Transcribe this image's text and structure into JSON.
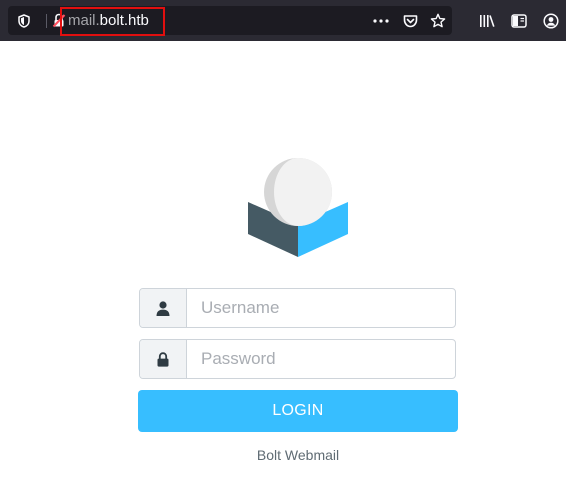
{
  "browser": {
    "url": {
      "host_prefix": "mail.",
      "domain": "bolt.htb"
    },
    "icons": {
      "tracking_protection": "shield-icon",
      "insecure_connection": "insecure-lock-icon",
      "page_actions": "more-horizontal-icon",
      "pocket": "pocket-icon",
      "bookmark": "star-icon",
      "library": "library-icon",
      "sidebar": "sidebar-icon",
      "account": "account-icon"
    },
    "highlight_color": "#e10f0f"
  },
  "login": {
    "logo": "roundcube-logo",
    "username": {
      "value": "",
      "placeholder": "Username",
      "icon": "user-icon"
    },
    "password": {
      "value": "",
      "placeholder": "Password",
      "icon": "lock-icon"
    },
    "submit_label": "LOGIN",
    "footer": "Bolt Webmail"
  },
  "colors": {
    "toolbar": "#2b2a33",
    "urlbar": "#1c1b22",
    "accent": "#37beff",
    "logo_dark": "#455a64"
  }
}
